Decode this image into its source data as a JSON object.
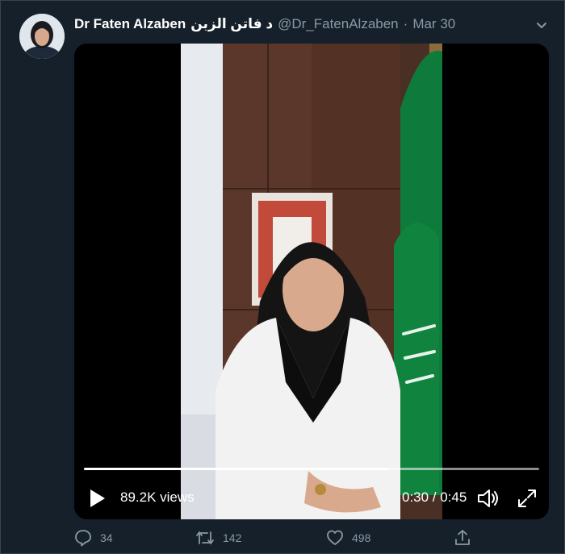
{
  "tweet": {
    "display_name": "Dr Faten Alzaben",
    "arabic_name": "د فاتن الزبن",
    "handle": "@Dr_FatenAlzaben",
    "separator": "·",
    "date": "Mar 30"
  },
  "video": {
    "views": "89.2K views",
    "time": "0:30 / 0:45",
    "progress": 0.667
  },
  "actions": {
    "reply_count": "34",
    "retweet_count": "142",
    "like_count": "498"
  },
  "colors": {
    "background": "#15202b",
    "secondary_text": "#8899a6",
    "flag_green": "#0e7a3c"
  },
  "icons": [
    "chevron-down-icon",
    "play-icon",
    "volume-icon",
    "fullscreen-icon",
    "reply-icon",
    "retweet-icon",
    "like-icon",
    "share-icon"
  ]
}
